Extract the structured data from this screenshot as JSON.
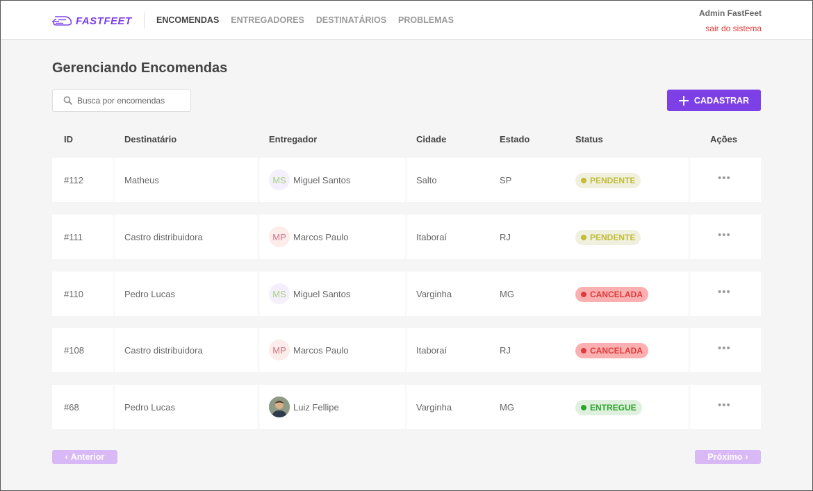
{
  "brand": {
    "name": "FASTFEET",
    "color": "#7d40e7"
  },
  "nav": [
    {
      "label": "ENCOMENDAS",
      "active": true
    },
    {
      "label": "ENTREGADORES",
      "active": false
    },
    {
      "label": "DESTINATÁRIOS",
      "active": false
    },
    {
      "label": "PROBLEMAS",
      "active": false
    }
  ],
  "user": {
    "name": "Admin FastFeet",
    "logout": "sair do sistema"
  },
  "page": {
    "title": "Gerenciando Encomendas"
  },
  "search": {
    "placeholder": "Busca por encomendas",
    "icon": "search-icon"
  },
  "add_button": {
    "label": "CADASTRAR",
    "icon": "plus-icon"
  },
  "table": {
    "headers": {
      "id": "ID",
      "recipient": "Destinatário",
      "deliveryman": "Entregador",
      "city": "Cidade",
      "state": "Estado",
      "status": "Status",
      "actions": "Ações"
    },
    "rows": [
      {
        "id": "#112",
        "recipient": "Matheus",
        "initials": "MS",
        "deliveryman": "Miguel Santos",
        "city": "Salto",
        "state": "SP",
        "status": "PENDENTE",
        "status_kind": "pending"
      },
      {
        "id": "#111",
        "recipient": "Castro distribuidora",
        "initials": "MP",
        "deliveryman": "Marcos Paulo",
        "city": "Itaboraí",
        "state": "RJ",
        "status": "PENDENTE",
        "status_kind": "pending"
      },
      {
        "id": "#110",
        "recipient": "Pedro Lucas",
        "initials": "MS",
        "deliveryman": "Miguel Santos",
        "city": "Varginha",
        "state": "MG",
        "status": "CANCELADA",
        "status_kind": "canceled"
      },
      {
        "id": "#108",
        "recipient": "Castro distribuidora",
        "initials": "MP",
        "deliveryman": "Marcos Paulo",
        "city": "Itaboraí",
        "state": "RJ",
        "status": "CANCELADA",
        "status_kind": "canceled"
      },
      {
        "id": "#68",
        "recipient": "Pedro Lucas",
        "initials": "",
        "deliveryman": "Luiz Fellipe",
        "city": "Varginha",
        "state": "MG",
        "status": "ENTREGUE",
        "status_kind": "delivered",
        "photo_avatar": true
      }
    ]
  },
  "colors": {
    "avatar_ms": {
      "bg": "#f4effc",
      "fg": "#a8d080"
    },
    "avatar_mp": {
      "bg": "#fcecea",
      "fg": "#cc7584"
    },
    "pending": {
      "bg": "#f0f0df",
      "fg": "#c1bc35",
      "dot": "#c1bc35"
    },
    "canceled": {
      "bg": "#fab0b0",
      "fg": "#de3b3b",
      "dot": "#de3b3b"
    },
    "delivered": {
      "bg": "#dff0df",
      "fg": "#2ca42b",
      "dot": "#2ca42b"
    }
  },
  "pagination": {
    "prev": "Anterior",
    "next": "Próximo"
  }
}
